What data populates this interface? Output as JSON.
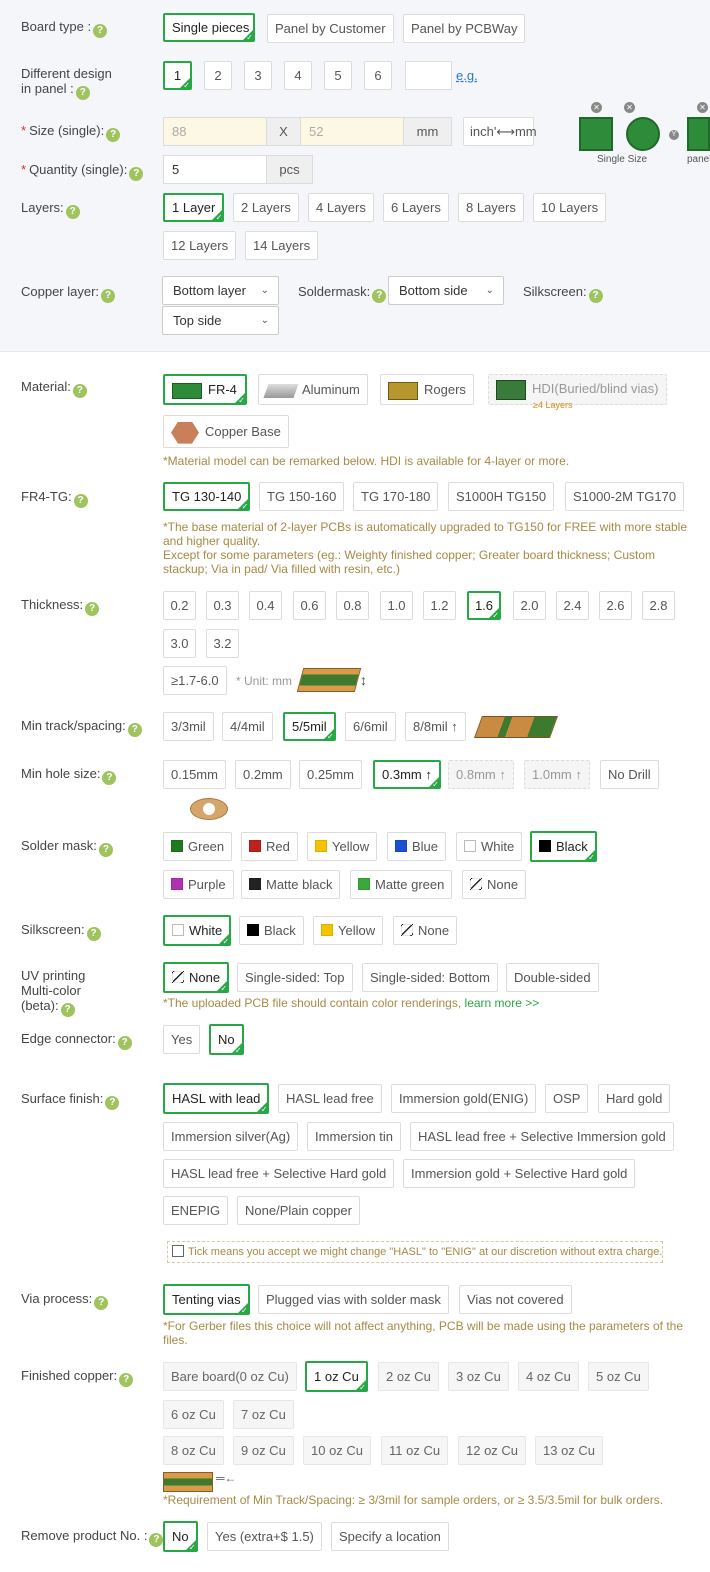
{
  "board_type": {
    "label": "Board type :",
    "options": [
      "Single pieces",
      "Panel by Customer",
      "Panel by PCBWay"
    ],
    "selected": 0
  },
  "design_in_panel": {
    "label_line1": "Different design",
    "label_line2": "in panel :",
    "options": [
      "1",
      "2",
      "3",
      "4",
      "5",
      "6"
    ],
    "selected": 0,
    "eg": "e.g."
  },
  "size": {
    "label": "Size (single):",
    "width": "88",
    "sep": "X",
    "height": "52",
    "unit": "mm",
    "convert": "inch'⟷mm"
  },
  "preview": {
    "single": "Single Size",
    "panel": "panel"
  },
  "quantity": {
    "label": "Quantity (single):",
    "value": "5",
    "unit": "pcs"
  },
  "layers": {
    "label": "Layers:",
    "options": [
      "1 Layer",
      "2 Layers",
      "4 Layers",
      "6 Layers",
      "8 Layers",
      "10 Layers",
      "12 Layers",
      "14 Layers"
    ],
    "selected": 0
  },
  "copper_layer": {
    "label": "Copper layer:",
    "value1": "Bottom layer",
    "value2": "Top side"
  },
  "soldermask_side": {
    "label": "Soldermask:",
    "value": "Bottom side"
  },
  "silkscreen_side": {
    "label": "Silkscreen:"
  },
  "material": {
    "label": "Material:",
    "options": [
      "FR-4",
      "Aluminum",
      "Rogers",
      "HDI(Buried/blind vias)",
      "Copper Base"
    ],
    "hdi_sub": "≥4 Layers",
    "selected": 0,
    "note": "*Material model can be remarked below. HDI is available for 4-layer or more."
  },
  "fr4_tg": {
    "label": "FR4-TG:",
    "options": [
      "TG 130-140",
      "TG 150-160",
      "TG 170-180",
      "S1000H TG150",
      "S1000-2M TG170"
    ],
    "selected": 0,
    "note1": "*The base material of 2-layer PCBs is automatically upgraded to TG150 for FREE with more stable",
    "note2": "and higher quality.",
    "note3": "Except for some parameters (eg.: Weighty finished copper; Greater board thickness; Custom",
    "note4": "stackup; Via in pad/ Via filled with resin, etc.)"
  },
  "thickness": {
    "label": "Thickness:",
    "options": [
      "0.2",
      "0.3",
      "0.4",
      "0.6",
      "0.8",
      "1.0",
      "1.2",
      "1.6",
      "2.0",
      "2.4",
      "2.6",
      "2.8",
      "3.0",
      "3.2"
    ],
    "selected": 7,
    "custom": "≥1.7-6.0",
    "unit": "* Unit: mm"
  },
  "min_track": {
    "label": "Min track/spacing:",
    "options": [
      "3/3mil",
      "4/4mil",
      "5/5mil",
      "6/6mil",
      "8/8mil ↑"
    ],
    "selected": 2
  },
  "min_hole": {
    "label": "Min hole size:",
    "options": [
      "0.15mm",
      "0.2mm",
      "0.25mm",
      "0.3mm ↑",
      "0.8mm ↑",
      "1.0mm ↑",
      "No Drill"
    ],
    "selected": 3
  },
  "solder_mask": {
    "label": "Solder mask:",
    "options": [
      "Green",
      "Red",
      "Yellow",
      "Blue",
      "White",
      "Black",
      "Purple",
      "Matte black",
      "Matte green",
      "None"
    ],
    "selected": 5,
    "colors": [
      "#1f7a1f",
      "#c0201e",
      "#f5c400",
      "#1b4fd6",
      "#ffffff",
      "#000000",
      "#b32fb3",
      "#222222",
      "#3aa83a",
      "none"
    ]
  },
  "silkscreen": {
    "label": "Silkscreen:",
    "options": [
      "White",
      "Black",
      "Yellow",
      "None"
    ],
    "selected": 0,
    "colors": [
      "#ffffff",
      "#000000",
      "#f5c400",
      "none"
    ]
  },
  "uv_printing": {
    "label_line1": "UV printing",
    "label_line2": "Multi-color",
    "label_line3": "(beta):",
    "options": [
      "None",
      "Single-sided: Top",
      "Single-sided: Bottom",
      "Double-sided"
    ],
    "selected": 0,
    "note": "*The uploaded PCB file should contain color renderings,",
    "learn": "learn more >>"
  },
  "edge_connector": {
    "label": "Edge connector:",
    "options": [
      "Yes",
      "No"
    ],
    "selected": 1
  },
  "surface_finish": {
    "label": "Surface finish:",
    "options": [
      "HASL with lead",
      "HASL lead free",
      "Immersion gold(ENIG)",
      "OSP",
      "Hard gold",
      "Immersion silver(Ag)",
      "Immersion tin",
      "HASL lead free + Selective Immersion gold",
      "HASL lead free + Selective Hard gold",
      "Immersion gold + Selective Hard gold",
      "ENEPIG",
      "None/Plain copper"
    ],
    "selected": 0,
    "tick_note": "Tick means you accept we might change \"HASL\" to \"ENIG\" at our discretion without extra charge."
  },
  "via_process": {
    "label": "Via process:",
    "options": [
      "Tenting vias",
      "Plugged vias with solder mask",
      "Vias not covered"
    ],
    "selected": 0,
    "note1": "*For Gerber files this choice will not affect anything, PCB will be made using the parameters of the",
    "note2": "files."
  },
  "finished_copper": {
    "label": "Finished copper:",
    "options": [
      "Bare board(0 oz Cu)",
      "1 oz Cu",
      "2 oz Cu",
      "3 oz Cu",
      "4 oz Cu",
      "5 oz Cu",
      "6 oz Cu",
      "7 oz Cu",
      "8 oz Cu",
      "9 oz Cu",
      "10 oz Cu",
      "11 oz Cu",
      "12 oz Cu",
      "13 oz Cu"
    ],
    "selected": 1,
    "note": "*Requirement of Min Track/Spacing: ≥ 3/3mil for sample orders, or ≥ 3.5/3.5mil for bulk orders."
  },
  "remove_product_no": {
    "label": "Remove product No. :",
    "options": [
      "No",
      "Yes (extra+$ 1.5)",
      "Specify a location"
    ],
    "selected": 0
  },
  "theme": {
    "accent": "#27a745",
    "note": "#a68a45",
    "section_bg": "#f4f6f9"
  }
}
